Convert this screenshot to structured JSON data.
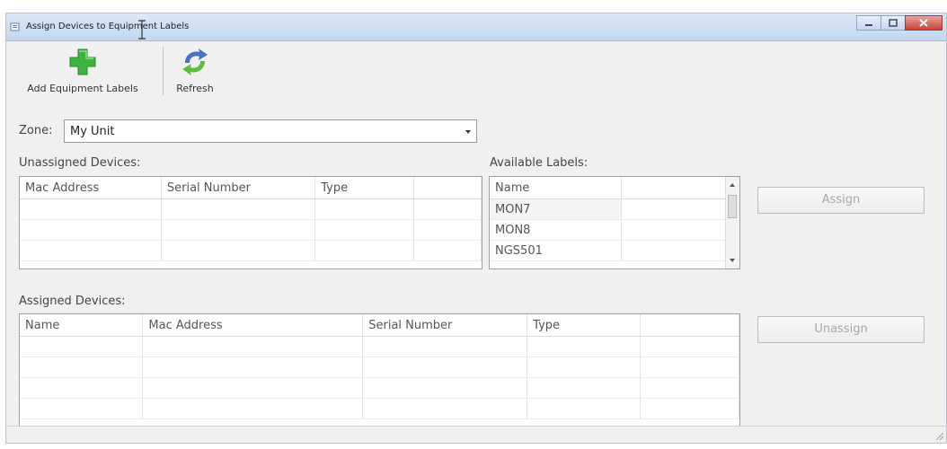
{
  "window": {
    "title": "Assign Devices to Equipment Labels"
  },
  "toolbar": {
    "add_label": "Add Equipment Labels",
    "refresh_label": "Refresh"
  },
  "zone": {
    "label": "Zone:",
    "value": "My Unit"
  },
  "unassigned": {
    "title": "Unassigned Devices:",
    "columns": [
      "Mac Address",
      "Serial Number",
      "Type"
    ]
  },
  "available": {
    "title": "Available Labels:",
    "header": "Name",
    "items": [
      "MON7",
      "MON8",
      "NGS501"
    ]
  },
  "assigned": {
    "title": "Assigned Devices:",
    "columns": [
      "Name",
      "Mac Address",
      "Serial Number",
      "Type"
    ]
  },
  "buttons": {
    "assign": "Assign",
    "unassign": "Unassign"
  },
  "colors": {
    "add_icon": "#3fb33f",
    "refresh_blue": "#4a6fc9",
    "refresh_green": "#5cbf3a",
    "close_button": "#c9443a"
  }
}
